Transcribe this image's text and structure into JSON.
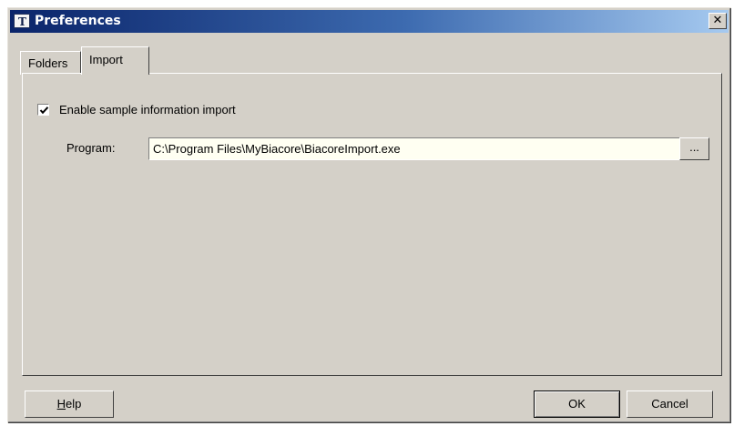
{
  "window": {
    "title": "Preferences",
    "app_icon_text": "T",
    "close_glyph": "✕"
  },
  "tabs": [
    {
      "label": "Folders",
      "active": false
    },
    {
      "label": "Import",
      "active": true
    }
  ],
  "import": {
    "enable_checkbox_label": "Enable sample information import",
    "enable_checked": true,
    "program_label": "Program:",
    "program_value": "C:\\Program Files\\MyBiacore\\BiacoreImport.exe",
    "browse_label": "..."
  },
  "buttons": {
    "help_label": "Help",
    "ok_label": "OK",
    "cancel_label": "Cancel"
  },
  "colors": {
    "titlebar_start": "#0a246a",
    "titlebar_end": "#a6caf0",
    "face": "#d4d0c8",
    "input_background": "#fffff2"
  }
}
